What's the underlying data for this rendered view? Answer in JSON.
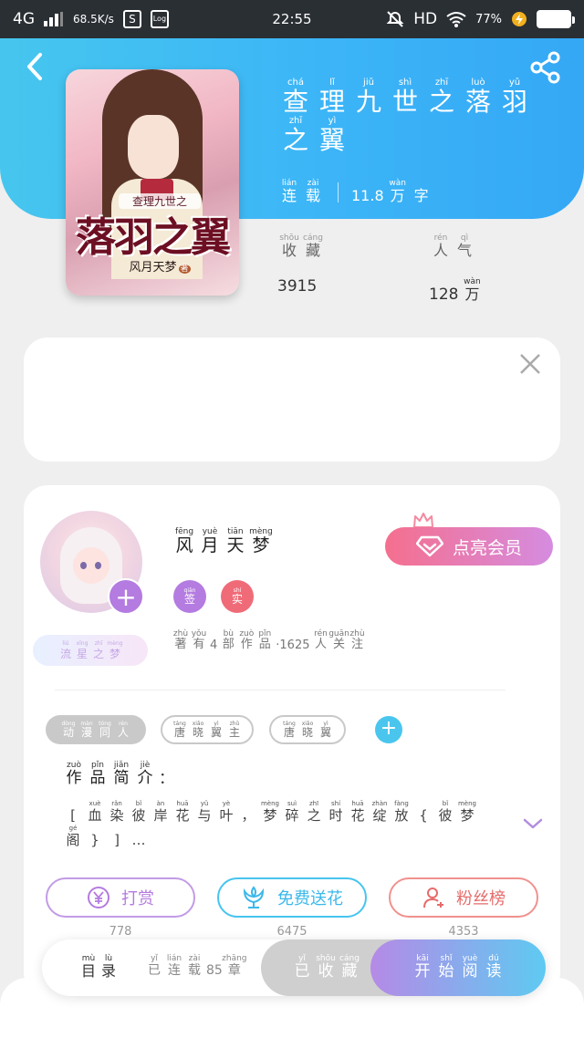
{
  "status_bar": {
    "network": "4G",
    "speed": "68.5K/s",
    "time": "22:55",
    "hd": "HD",
    "battery": "77%",
    "icons": [
      "signal-icon",
      "s-app-icon",
      "log-app-icon",
      "mute-icon",
      "wifi-icon",
      "charging-icon"
    ]
  },
  "header": {
    "back_icon": "back-arrow-icon",
    "share_icon": "share-icon"
  },
  "book": {
    "cover": {
      "small_title": "查理九世之",
      "big_title": "落羽之翼",
      "author_tag": "风月天梦",
      "author_tag_mark": "著"
    },
    "title_chars": [
      {
        "py": "chá",
        "hz": "查"
      },
      {
        "py": "lǐ",
        "hz": "理"
      },
      {
        "py": "jiǔ",
        "hz": "九"
      },
      {
        "py": "shì",
        "hz": "世"
      },
      {
        "py": "zhī",
        "hz": "之"
      },
      {
        "py": "luò",
        "hz": "落"
      },
      {
        "py": "yǔ",
        "hz": "羽"
      },
      {
        "py": "zhī",
        "hz": "之"
      },
      {
        "py": "yì",
        "hz": "翼"
      }
    ],
    "status_chars": [
      {
        "py": "lián",
        "hz": "连"
      },
      {
        "py": "zài",
        "hz": "载"
      }
    ],
    "word_count_num": "11.8",
    "word_count_unit": [
      {
        "py": "wàn",
        "hz": "万"
      },
      {
        "py": "",
        "hz": "字"
      }
    ],
    "fav_label": [
      {
        "py": "shōu",
        "hz": "收"
      },
      {
        "py": "cáng",
        "hz": "藏"
      }
    ],
    "fav_value": "3915",
    "pop_label": [
      {
        "py": "rén",
        "hz": "人"
      },
      {
        "py": "qì",
        "hz": "气"
      }
    ],
    "pop_value_num": "128",
    "pop_value_unit": {
      "py": "wàn",
      "hz": "万"
    }
  },
  "ad": {
    "close_icon": "close-icon"
  },
  "author": {
    "name_chars": [
      {
        "py": "fēng",
        "hz": "风"
      },
      {
        "py": "yuè",
        "hz": "月"
      },
      {
        "py": "tiān",
        "hz": "天"
      },
      {
        "py": "mèng",
        "hz": "梦"
      }
    ],
    "nickname_chars": [
      {
        "py": "liú",
        "hz": "流"
      },
      {
        "py": "xīng",
        "hz": "星"
      },
      {
        "py": "zhī",
        "hz": "之"
      },
      {
        "py": "mèng",
        "hz": "梦"
      }
    ],
    "badges": {
      "sign": {
        "py": "qiān",
        "hz": "签"
      },
      "real": {
        "py": "shí",
        "hz": "实"
      }
    },
    "stats_prefix": [
      {
        "py": "zhù",
        "hz": "著"
      },
      {
        "py": "yǒu",
        "hz": "有"
      }
    ],
    "works_count": "4",
    "stats_mid": [
      {
        "py": "bù",
        "hz": "部"
      },
      {
        "py": "zuò",
        "hz": "作"
      },
      {
        "py": "pǐn",
        "hz": "品"
      }
    ],
    "followers_count": "·1625",
    "stats_suffix": [
      {
        "py": "rén",
        "hz": "人"
      },
      {
        "py": "guān",
        "hz": "关"
      },
      {
        "py": "zhù",
        "hz": "注"
      }
    ],
    "vip_button": "点亮会员",
    "follow_icon": "plus-icon"
  },
  "tags": [
    [
      {
        "py": "dòng",
        "hz": "动"
      },
      {
        "py": "màn",
        "hz": "漫"
      },
      {
        "py": "tóng",
        "hz": "同"
      },
      {
        "py": "rén",
        "hz": "人"
      }
    ],
    [
      {
        "py": "táng",
        "hz": "唐"
      },
      {
        "py": "xiǎo",
        "hz": "晓"
      },
      {
        "py": "yì",
        "hz": "翼"
      },
      {
        "py": "zhǔ",
        "hz": "主"
      }
    ],
    [
      {
        "py": "táng",
        "hz": "唐"
      },
      {
        "py": "xiǎo",
        "hz": "晓"
      },
      {
        "py": "yì",
        "hz": "翼"
      }
    ]
  ],
  "intro": {
    "title_chars": [
      {
        "py": "zuò",
        "hz": "作"
      },
      {
        "py": "pǐn",
        "hz": "品"
      },
      {
        "py": "jiǎn",
        "hz": "简"
      },
      {
        "py": "jiè",
        "hz": "介"
      }
    ],
    "title_colon": "：",
    "text_chars": [
      {
        "py": "",
        "hz": "["
      },
      {
        "py": "xuè",
        "hz": "血"
      },
      {
        "py": "rǎn",
        "hz": "染"
      },
      {
        "py": "bǐ",
        "hz": "彼"
      },
      {
        "py": "àn",
        "hz": "岸"
      },
      {
        "py": "huā",
        "hz": "花"
      },
      {
        "py": "yǔ",
        "hz": "与"
      },
      {
        "py": "yè",
        "hz": "叶"
      },
      {
        "py": "",
        "hz": "，"
      },
      {
        "py": "mèng",
        "hz": "梦"
      },
      {
        "py": "suì",
        "hz": "碎"
      },
      {
        "py": "zhī",
        "hz": "之"
      },
      {
        "py": "shí",
        "hz": "时"
      },
      {
        "py": "huā",
        "hz": "花"
      },
      {
        "py": "zhàn",
        "hz": "绽"
      },
      {
        "py": "fàng",
        "hz": "放"
      },
      {
        "py": "",
        "hz": "{"
      },
      {
        "py": "bǐ",
        "hz": "彼"
      },
      {
        "py": "mèng",
        "hz": "梦"
      },
      {
        "py": "gé",
        "hz": "阁"
      },
      {
        "py": "",
        "hz": "}"
      },
      {
        "py": "",
        "hz": "]"
      },
      {
        "py": "",
        "hz": "…"
      }
    ],
    "expand_icon": "chevron-down-icon"
  },
  "actions": {
    "tip_label": "打赏",
    "tip_count": "778",
    "flower_label": "免费送花",
    "flower_count": "6475",
    "fans_label": "粉丝榜",
    "fans_count": "4353"
  },
  "bottom_bar": {
    "toc_chars": [
      {
        "py": "mù",
        "hz": "目"
      },
      {
        "py": "lù",
        "hz": "录"
      }
    ],
    "serial_prefix": [
      {
        "py": "yǐ",
        "hz": "已"
      },
      {
        "py": "lián",
        "hz": "连"
      },
      {
        "py": "zài",
        "hz": "载"
      }
    ],
    "serial_count": "85",
    "serial_suffix": [
      {
        "py": "zhāng",
        "hz": "章"
      }
    ],
    "collected_chars": [
      {
        "py": "yǐ",
        "hz": "已"
      },
      {
        "py": "shōu",
        "hz": "收"
      },
      {
        "py": "cáng",
        "hz": "藏"
      }
    ],
    "read_chars": [
      {
        "py": "kāi",
        "hz": "开"
      },
      {
        "py": "shǐ",
        "hz": "始"
      },
      {
        "py": "yuè",
        "hz": "阅"
      },
      {
        "py": "dú",
        "hz": "读"
      }
    ]
  },
  "colors": {
    "header_gradient_start": "#46c6ee",
    "header_gradient_end": "#35a8f5",
    "vip_gradient_start": "#f56f8e",
    "vip_gradient_end": "#d58ce0",
    "read_gradient_start": "#b58ae6",
    "read_gradient_end": "#5ecaf2",
    "tip": "#b47be0",
    "flower": "#3cb8ea",
    "fans": "#e66b6b"
  }
}
